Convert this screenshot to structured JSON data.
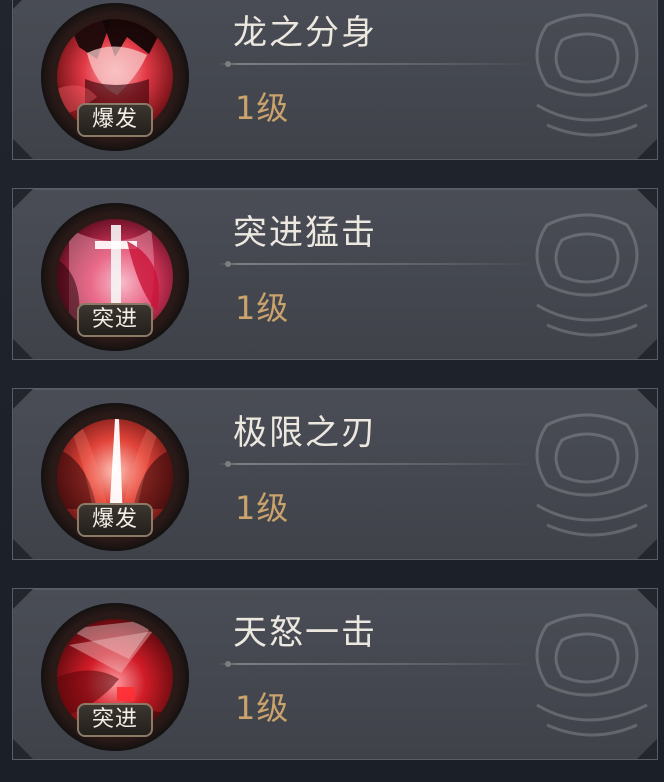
{
  "skills": [
    {
      "name": "龙之分身",
      "tag": "爆发",
      "level": "1级",
      "icon": "dragon-clone-skill-icon",
      "colors": {
        "art_base": "#7a0f14",
        "art_glow": "#ff4c55"
      }
    },
    {
      "name": "突进猛击",
      "tag": "突进",
      "level": "1级",
      "icon": "charge-strike-skill-icon",
      "colors": {
        "art_base": "#7a0c22",
        "art_glow": "#ff6a7f"
      }
    },
    {
      "name": "极限之刃",
      "tag": "爆发",
      "level": "1级",
      "icon": "limit-blade-skill-icon",
      "colors": {
        "art_base": "#6f0c10",
        "art_glow": "#ff5a46"
      }
    },
    {
      "name": "天怒一击",
      "tag": "突进",
      "level": "1级",
      "icon": "heavens-wrath-skill-icon",
      "colors": {
        "art_base": "#7d0b12",
        "art_glow": "#ff2e34"
      }
    }
  ],
  "theme": {
    "card_bg": "#474a52",
    "level_color": "#caa26b",
    "name_color": "#ece8e0"
  }
}
